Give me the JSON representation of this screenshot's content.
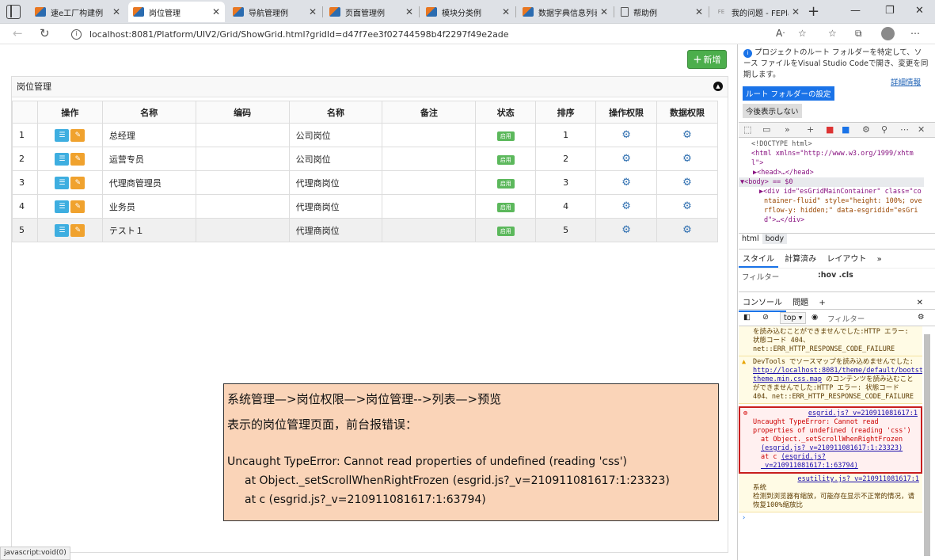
{
  "tabs": [
    {
      "label": "速e工厂构建例",
      "active": false
    },
    {
      "label": "岗位管理",
      "active": true
    },
    {
      "label": "导航管理例",
      "active": false
    },
    {
      "label": "页面管理例",
      "active": false
    },
    {
      "label": "模块分类例",
      "active": false
    },
    {
      "label": "数据字典信息列表",
      "active": false
    },
    {
      "label": "帮助例",
      "active": false
    },
    {
      "label": "我的问题 - FEPlat",
      "active": false
    }
  ],
  "address": {
    "url": "localhost:8081/Platform/UIV2/Grid/ShowGrid.html?gridId=d47f7ee3f02744598b4f2297f49e2ade"
  },
  "page": {
    "add_label": "新增",
    "panel_title": "岗位管理",
    "columns": [
      "操作",
      "名称",
      "编码",
      "名称",
      "备注",
      "状态",
      "排序",
      "操作权限",
      "数据权限"
    ],
    "rows": [
      {
        "no": "1",
        "name": "总经理",
        "code": "",
        "type": "公司岗位",
        "note": "",
        "status": "启用",
        "sort": "1"
      },
      {
        "no": "2",
        "name": "运营专员",
        "code": "",
        "type": "公司岗位",
        "note": "",
        "status": "启用",
        "sort": "2"
      },
      {
        "no": "3",
        "name": "代理商管理员",
        "code": "",
        "type": "代理商岗位",
        "note": "",
        "status": "启用",
        "sort": "3"
      },
      {
        "no": "4",
        "name": "业务员",
        "code": "",
        "type": "代理商岗位",
        "note": "",
        "status": "启用",
        "sort": "4"
      },
      {
        "no": "5",
        "name": "テスト１",
        "code": "",
        "type": "代理商岗位",
        "note": "",
        "status": "启用",
        "sort": "5"
      }
    ],
    "status_bar": "javascript:void(0)"
  },
  "note": {
    "line1": "系统管理—>岗位权限—>岗位管理-->列表—>预览",
    "line2": "表示的岗位管理页面，前台报错误：",
    "line3": "Uncaught TypeError: Cannot read properties of undefined (reading 'css')",
    "line4": "at Object._setScrollWhenRightFrozen (esgrid.js?_v=210911081617:1:23323)",
    "line5": "at c (esgrid.js?_v=210911081617:1:63794)"
  },
  "devtools": {
    "hint": "プロジェクトのルート フォルダーを特定して、ソース ファイルをVisual Studio Codeで開き、変更を同期します。",
    "detail_link": "詳細情報",
    "set_root": "ルート フォルダーの設定",
    "hide": "今後表示しない",
    "dom": [
      "<!DOCTYPE html>",
      "<html xmlns=\"http://www.w3.org/1999/xhtm",
      "l\">",
      "▶<head>…</head>",
      "▼<body> == $0",
      "▶<div id=\"esGridMainContainer\" class=\"co",
      "ntainer-fluid\" style=\"height: 100%; ove",
      "rflow-y: hidden;\" data-esgridid=\"esGri",
      "d\">…</div>"
    ],
    "crumbs": [
      "html",
      "body"
    ],
    "style_tabs": [
      "スタイル",
      "計算済み",
      "レイアウト"
    ],
    "filter": "フィルター",
    "filter_opts": ":hov  .cls",
    "console_tabs": [
      "コンソール",
      "問題"
    ],
    "context": "top",
    "console_filter": "フィルター",
    "msg1": "を読み込むことができませんでした:HTTP エラー: 状態コード 404、net::ERR_HTTP_RESPONSE_CODE_FAILURE",
    "msg2_a": "DevTools でソースマップを読み込めませんでした:",
    "msg2_link": "http://localhost:8081/theme/default/bootstrap-theme.min.css.map",
    "msg2_b": "のコンテンツを読み込むことができませんでした:HTTP エラー: 状態コード 404、net::ERR_HTTP_RESPONSE_CODE_FAILURE",
    "err_src": "esgrid.js?_v=210911081617:1",
    "err_text": "Uncaught TypeError: Cannot read properties of undefined (reading 'css')",
    "err_at1": "at Object._setScrollWhenRightFrozen",
    "err_at1_link": "(esgrid.js?_v=210911081617:1:23323)",
    "err_at2": "at c",
    "err_at2_link": "(esgrid.js?_v=210911081617:1:63794)",
    "msg3_src": "esutility.js?_v=210911081617:1",
    "msg3_a": "系统",
    "msg3_b": "检测到浏览器有缩放，可能存在显示不正常的情况，请恢复100%缩放比"
  }
}
